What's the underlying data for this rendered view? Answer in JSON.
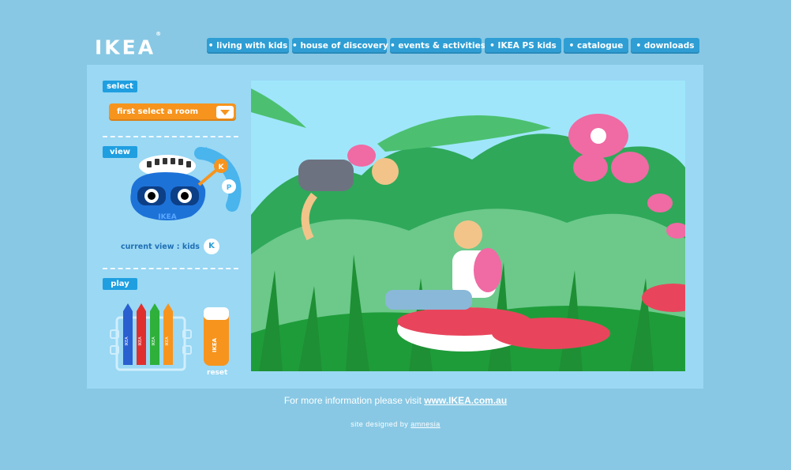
{
  "brand": {
    "logo": "IKEA",
    "trademark": "®"
  },
  "nav": [
    "• living with kids",
    "• house of discovery",
    "• events & activities",
    "• IKEA PS kids",
    "• catalogue",
    "• downloads"
  ],
  "select": {
    "label": "select",
    "dropdown_value": "first select a room"
  },
  "view": {
    "label": "view",
    "viewer_brand": "IKEA",
    "current_view_label": "current view : kids",
    "current_view_badge": "K",
    "dial_options": [
      "K",
      "P"
    ]
  },
  "play": {
    "label": "play",
    "pencil_brand": "IKEA",
    "eraser_brand": "IKEA",
    "reset_label": "reset"
  },
  "footer": {
    "info_text": "For more information please visit ",
    "info_link": "www.IKEA.com.au",
    "credit_text": "site designed by ",
    "credit_link": "amnesia"
  },
  "colors": {
    "background": "#88c8e4",
    "panel": "#9ad8f4",
    "nav_button": "#2e9ed4",
    "tag": "#1f9fe0",
    "dropdown": "#f7941d"
  }
}
